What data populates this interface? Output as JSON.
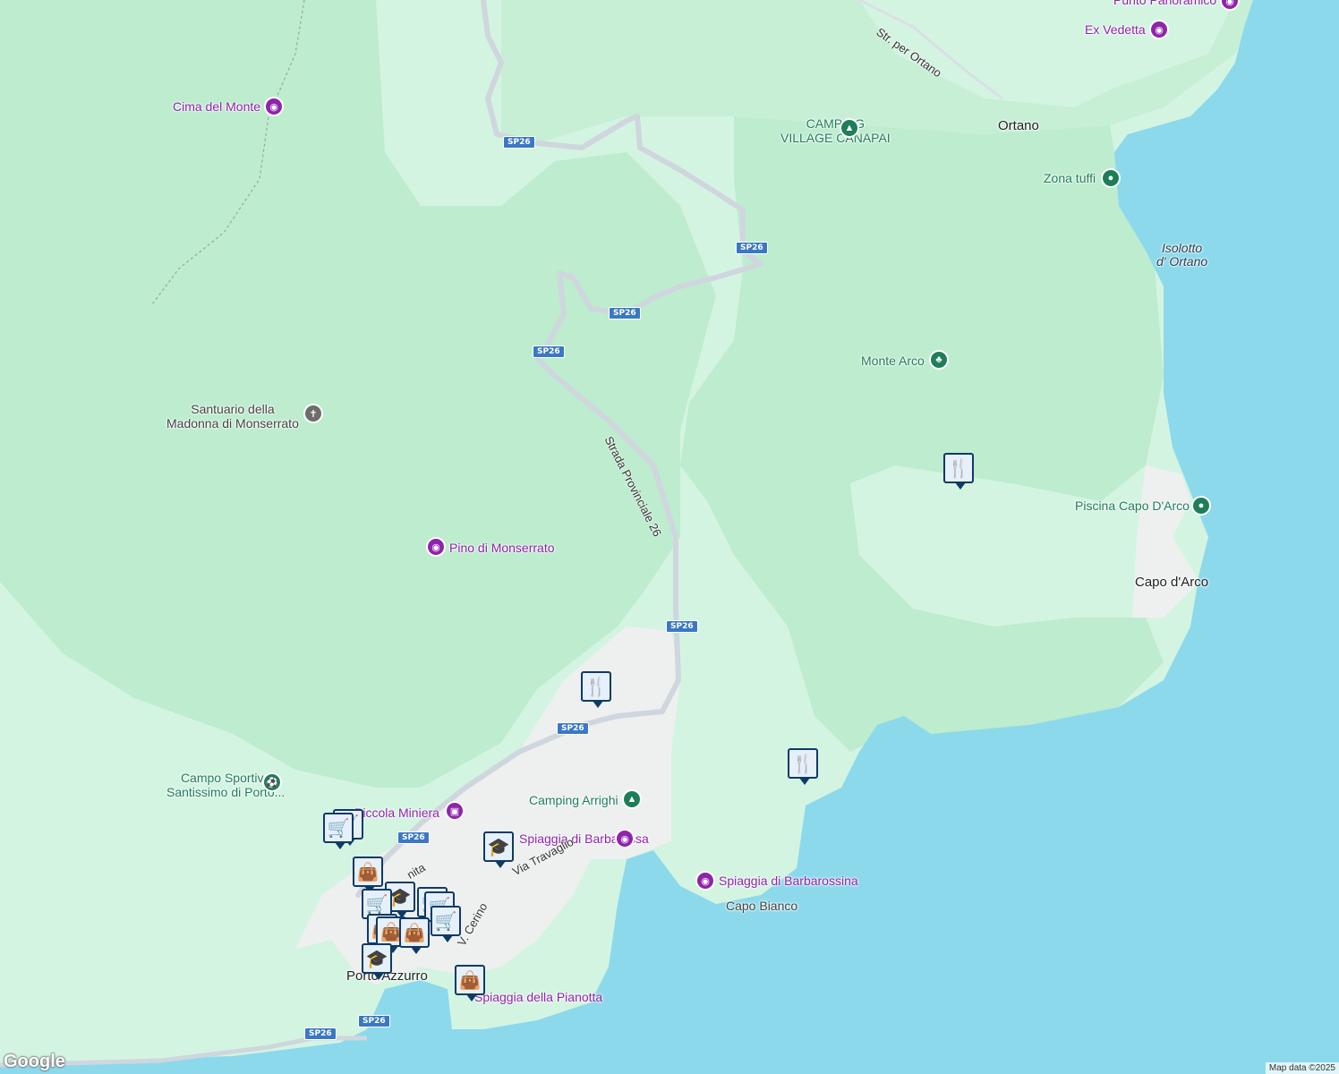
{
  "map": {
    "attribution": "Map data ©2025",
    "logo": "Google",
    "colors": {
      "sea": "#8cd9ec",
      "forest": "#bdeccf",
      "land": "#d4f4e2",
      "urban": "#eef0f0",
      "road": "#cfd6dd",
      "poi": "#8e24aa",
      "green_poi": "#1e7e5a",
      "pin": "#0e3a66"
    }
  },
  "places": {
    "cima_del_monte": "Cima del Monte",
    "punto_panoramico": "Punto Panoramico",
    "ex_vedetta": "Ex Vedetta",
    "str_per_ortano": "Str. per Ortano",
    "camping_canapai_1": "CAMPING",
    "camping_canapai_2": "VILLAGE CANAPAI",
    "ortano": "Ortano",
    "zona_tuffi": "Zona tuffi",
    "isolotto_1": "Isolotto",
    "isolotto_2": "d' Ortano",
    "monte_arco": "Monte Arco",
    "santuario_1": "Santuario della",
    "santuario_2": "Madonna di Monserrato",
    "strada_provinciale": "Strada Provinciale 26",
    "piscina": "Piscina Capo D'Arco",
    "capo_darco": "Capo d'Arco",
    "pino": "Pino di Monserrato",
    "campo_1": "Campo Sportivo",
    "campo_2": "Santissimo di Porto...",
    "piccola_miniera": "Piccola Miniera",
    "camping_arrighi": "Camping Arrighi",
    "spiaggia_barbarossa": "Spiaggia di Barbarossa",
    "via_travaglio": "Via Travaglio",
    "spiaggia_barbarossina": "Spiaggia di Barbarossina",
    "capo_bianco": "Capo Bianco",
    "porto_azzurro": "Porto Azzurro",
    "spiaggia_pianotta": "Spiaggia della Pianotta",
    "road_fragment_1": "nita",
    "road_fragment_2": "V. Cerino"
  },
  "road_shields": {
    "sp26": "SP26"
  },
  "icons": {
    "camera": "camera-icon",
    "camping": "camping-icon",
    "pin": "location-pin-icon",
    "tree": "tree-icon",
    "church": "church-icon",
    "sports": "sports-icon",
    "museum": "museum-icon",
    "restaurant": "restaurant-icon",
    "shopping_cart": "shopping-cart-icon",
    "shopping_bag": "shopping-bag-icon",
    "school": "school-icon"
  }
}
